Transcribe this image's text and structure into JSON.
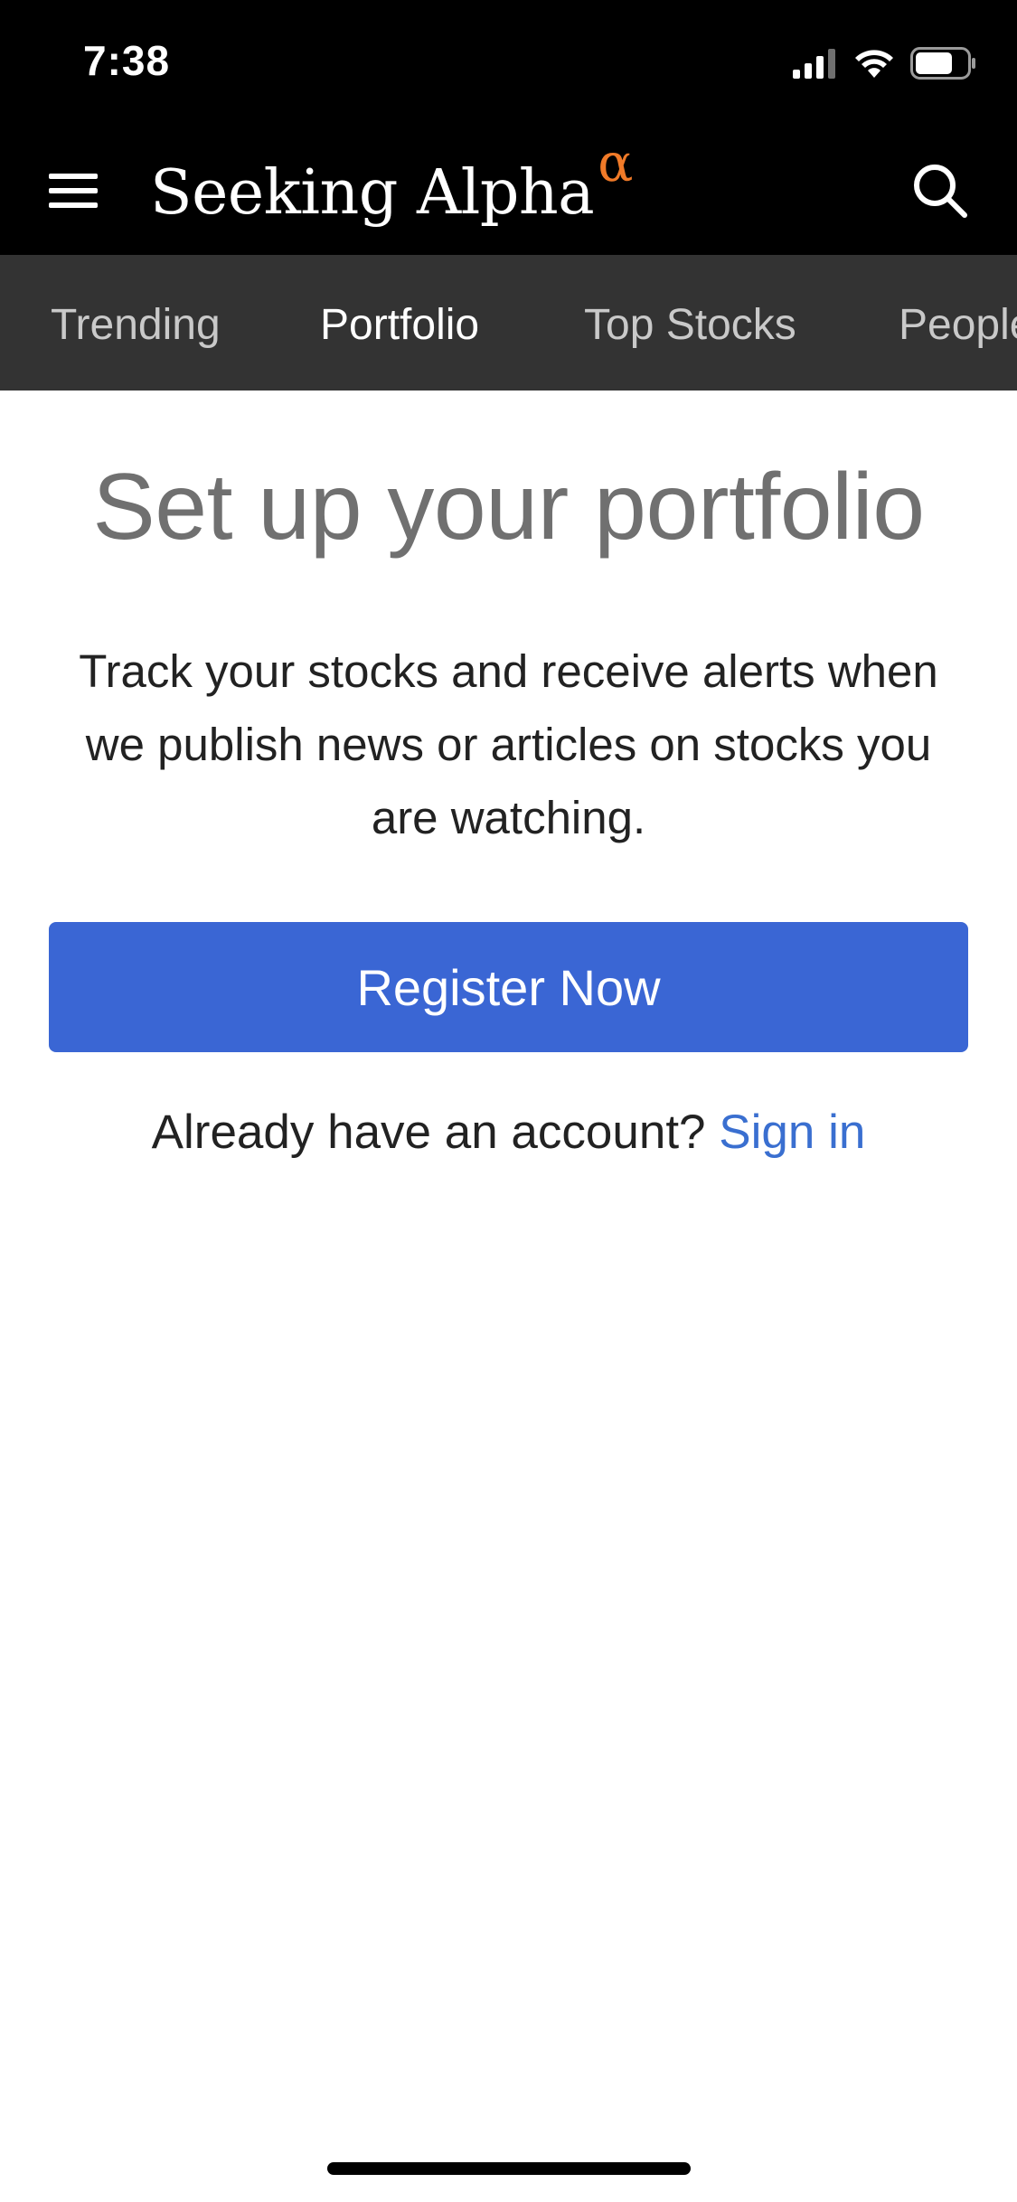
{
  "status_bar": {
    "time": "7:38",
    "icons": [
      "cellular-signal-icon",
      "wifi-icon",
      "battery-icon"
    ]
  },
  "header": {
    "logo_text": "Seeking Alpha",
    "logo_symbol": "α",
    "logo_symbol_color": "#f07a28",
    "menu_icon": "hamburger-menu-icon",
    "search_icon": "search-icon"
  },
  "tabs": [
    {
      "label": "Trending",
      "active": false
    },
    {
      "label": "Portfolio",
      "active": true
    },
    {
      "label": "Top Stocks",
      "active": false
    },
    {
      "label": "People",
      "active": false
    }
  ],
  "main": {
    "title": "Set up your portfolio",
    "description": "Track your stocks and receive alerts when we publish news or articles on stocks you are watching.",
    "register_label": "Register Now",
    "register_color": "#3a66d4",
    "account_prompt": "Already have an account?",
    "signin_label": "Sign in",
    "signin_color": "#3a6fd0"
  }
}
